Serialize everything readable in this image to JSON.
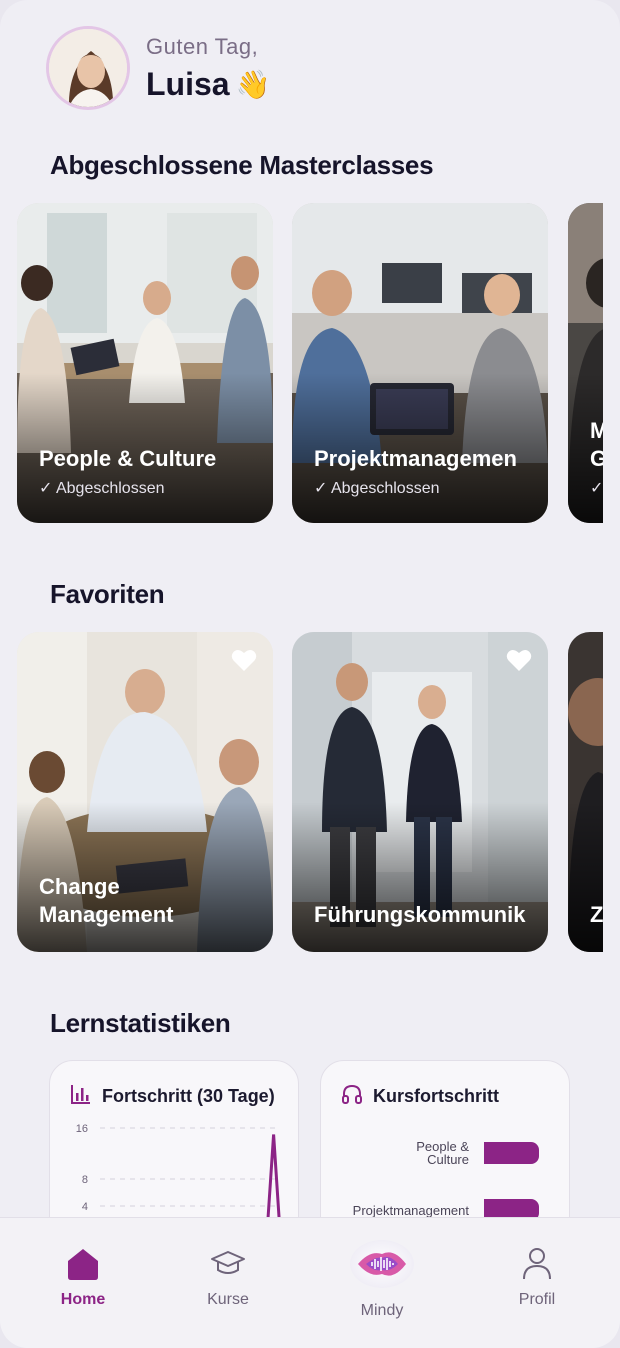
{
  "greeting": {
    "line1": "Guten Tag,",
    "name": "Luisa",
    "emoji": "👋"
  },
  "sections": {
    "completed_title": "Abgeschlossene Masterclasses",
    "favorites_title": "Favoriten",
    "stats_title": "Lernstatistiken"
  },
  "completed": [
    {
      "title": "People & Culture",
      "status": "✓ Abgeschlossen"
    },
    {
      "title": "Projektmanagemen",
      "status": "✓ Abgeschlossen"
    },
    {
      "title_line1": "M",
      "title_line2": "G",
      "status": "✓"
    }
  ],
  "favorites": [
    {
      "title_line1": "Change",
      "title_line2": "Management"
    },
    {
      "title": "Führungskommunik"
    },
    {
      "title": "Z"
    }
  ],
  "stats": {
    "progress": {
      "title": "Fortschritt (30 Tage)",
      "icon": "bar-chart-icon",
      "y_ticks": [
        "16",
        "8",
        "4"
      ]
    },
    "course": {
      "title": "Kursfortschritt",
      "icon": "headphones-icon",
      "rows": [
        {
          "label_line1": "People &",
          "label_line2": "Culture"
        },
        {
          "label": "Projektmanagement"
        }
      ]
    }
  },
  "chart_data": [
    {
      "type": "line",
      "title": "Fortschritt (30 Tage)",
      "y_ticks": [
        4,
        8,
        16
      ],
      "series": [
        {
          "values": [
            0,
            0,
            0,
            0,
            0,
            0,
            0,
            0,
            0,
            0,
            0,
            0,
            0,
            0,
            0,
            0,
            0,
            0,
            0,
            0,
            0,
            0,
            0,
            0,
            0,
            0,
            0,
            15,
            0
          ]
        }
      ]
    }
  ],
  "nav": {
    "home": "Home",
    "courses": "Kurse",
    "mindy": "Mindy",
    "profile": "Profil"
  },
  "colors": {
    "accent": "#8c2486",
    "background": "#efeef4"
  }
}
